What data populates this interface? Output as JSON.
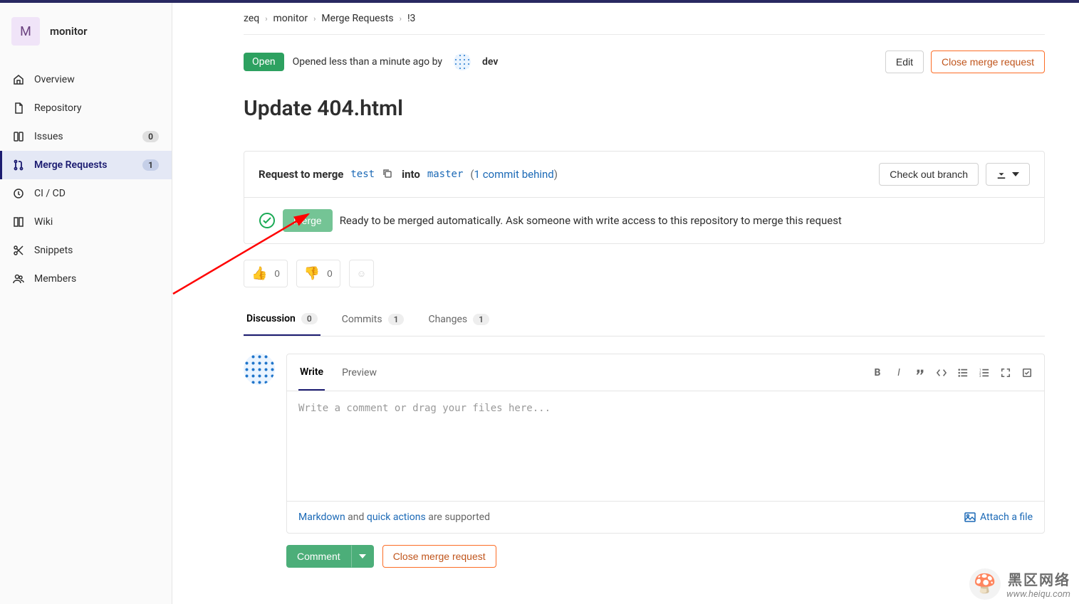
{
  "project": {
    "avatar_letter": "M",
    "name": "monitor"
  },
  "sidebar": {
    "items": [
      {
        "label": "Overview"
      },
      {
        "label": "Repository"
      },
      {
        "label": "Issues",
        "badge": "0"
      },
      {
        "label": "Merge Requests",
        "badge": "1"
      },
      {
        "label": "CI / CD"
      },
      {
        "label": "Wiki"
      },
      {
        "label": "Snippets"
      },
      {
        "label": "Members"
      }
    ]
  },
  "breadcrumb": {
    "group": "zeq",
    "project": "monitor",
    "section": "Merge Requests",
    "id": "!3"
  },
  "mr": {
    "status": "Open",
    "opened_text": "Opened less than a minute ago by",
    "author": "dev",
    "edit_label": "Edit",
    "close_label": "Close merge request",
    "title": "Update 404.html"
  },
  "merge_box": {
    "request_label": "Request to merge",
    "source_branch": "test",
    "into_label": "into",
    "target_branch": "master",
    "behind_prefix": "(",
    "behind_link": "1 commit behind",
    "behind_suffix": ")",
    "checkout_label": "Check out branch",
    "merge_button": "Merge",
    "ready_text": "Ready to be merged automatically. Ask someone with write access to this repository to merge this request"
  },
  "awards": {
    "thumbs_up": "0",
    "thumbs_down": "0"
  },
  "tabs": {
    "discussion": {
      "label": "Discussion",
      "count": "0"
    },
    "commits": {
      "label": "Commits",
      "count": "1"
    },
    "changes": {
      "label": "Changes",
      "count": "1"
    }
  },
  "comment": {
    "write_tab": "Write",
    "preview_tab": "Preview",
    "placeholder": "Write a comment or drag your files here...",
    "markdown_link": "Markdown",
    "and_text": " and ",
    "quick_actions_link": "quick actions",
    "supported_text": " are supported",
    "attach_label": "Attach a file",
    "comment_button": "Comment",
    "close_button": "Close merge request"
  },
  "watermark": {
    "line1": "黑区网络",
    "line2": "www.heiqu.com"
  }
}
